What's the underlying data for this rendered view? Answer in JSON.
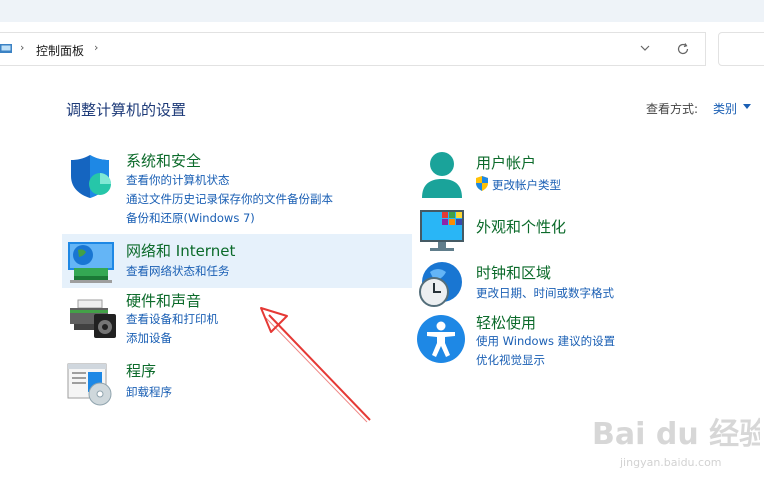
{
  "address": {
    "crumb": "控制面板"
  },
  "header": {
    "title": "调整计算机的设置",
    "view_by_label": "查看方式:",
    "view_by_value": "类别"
  },
  "categories": {
    "system": {
      "title": "系统和安全",
      "links": [
        "查看你的计算机状态",
        "通过文件历史记录保存你的文件备份副本",
        "备份和还原(Windows 7)"
      ]
    },
    "network": {
      "title": "网络和 Internet",
      "links": [
        "查看网络状态和任务"
      ]
    },
    "hardware": {
      "title": "硬件和声音",
      "links": [
        "查看设备和打印机",
        "添加设备"
      ]
    },
    "programs": {
      "title": "程序",
      "links": [
        "卸载程序"
      ]
    },
    "accounts": {
      "title": "用户帐户",
      "links": [
        "更改帐户类型"
      ]
    },
    "appearance": {
      "title": "外观和个性化"
    },
    "clock": {
      "title": "时钟和区域",
      "links": [
        "更改日期、时间或数字格式"
      ]
    },
    "ease": {
      "title": "轻松使用",
      "links": [
        "使用 Windows 建议的设置",
        "优化视觉显示"
      ]
    }
  },
  "watermark": {
    "brand": "Bai du 经验",
    "url": "jingyan.baidu.com"
  }
}
